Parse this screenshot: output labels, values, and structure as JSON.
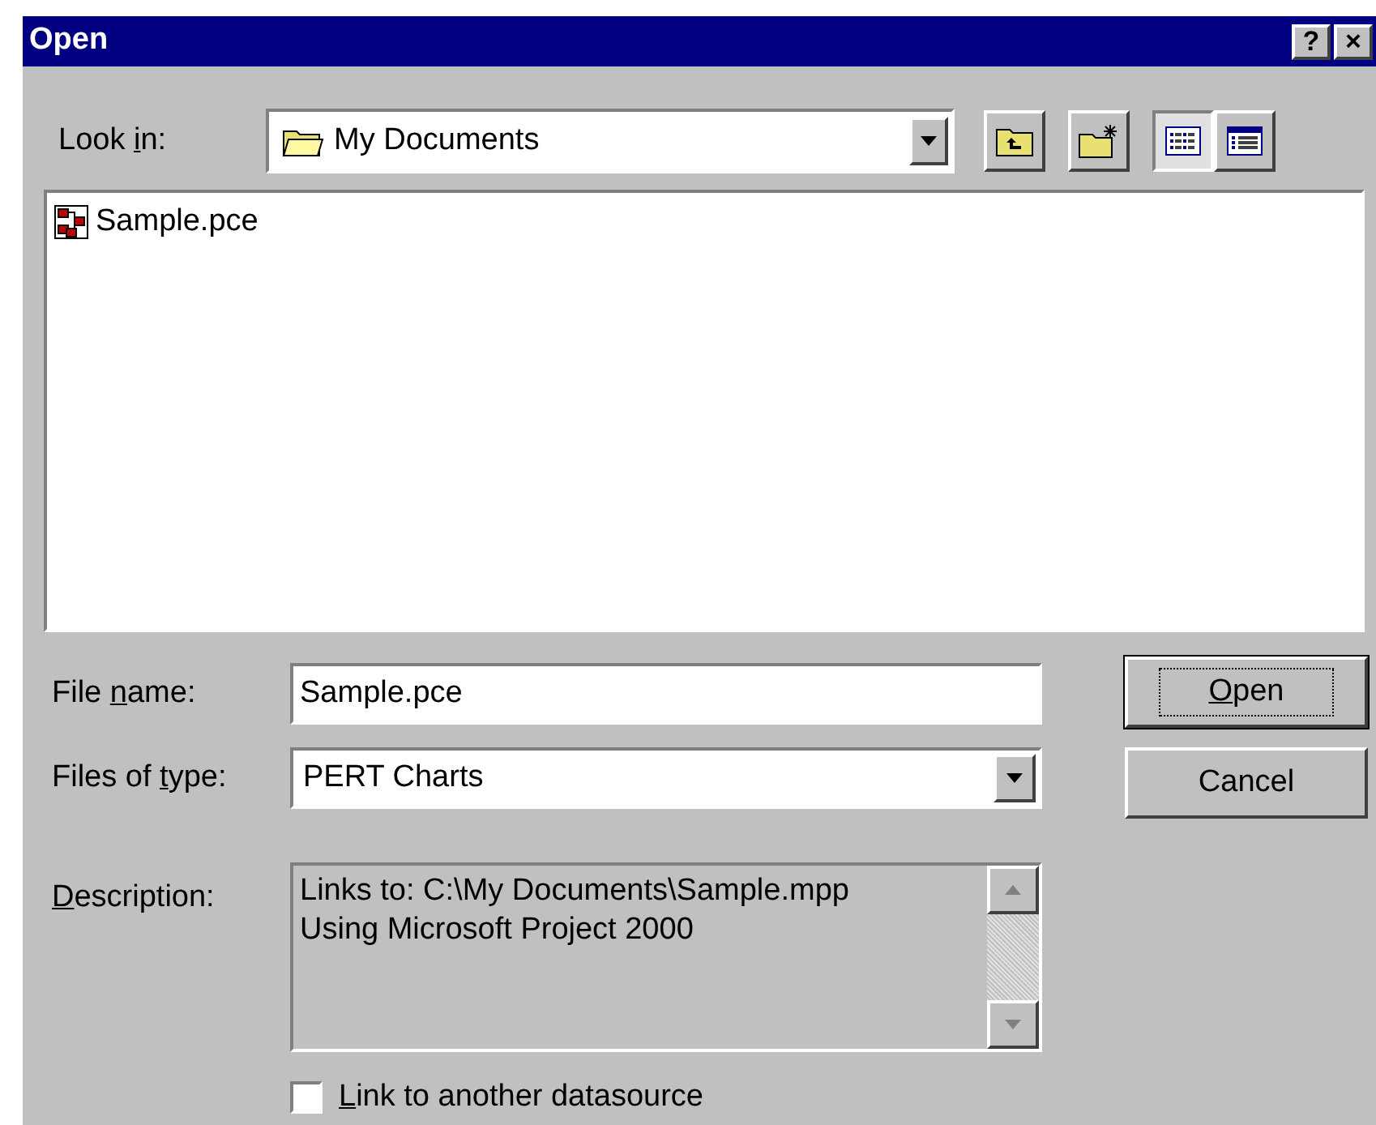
{
  "window": {
    "title": "Open",
    "title_buttons": [
      "?",
      "×"
    ]
  },
  "look_in": {
    "label": {
      "before": "Look ",
      "key": "i",
      "after": "n:"
    },
    "value": "My Documents"
  },
  "toolbar": [
    {
      "kind": "up",
      "selected": false
    },
    {
      "kind": "new-folder",
      "selected": false
    },
    {
      "kind": "list",
      "selected": true
    },
    {
      "kind": "details",
      "selected": false
    }
  ],
  "files": [
    {
      "name": "Sample.pce"
    }
  ],
  "file_name": {
    "label": {
      "before": "File ",
      "key": "n",
      "after": "ame:"
    },
    "value": "Sample.pce"
  },
  "file_type": {
    "label": {
      "before": "Files of ",
      "key": "t",
      "after": "ype:"
    },
    "value": "PERT Charts"
  },
  "buttons": [
    {
      "label": {
        "key": "O",
        "after": "pen"
      },
      "default": true
    },
    {
      "label": {
        "before": "Cancel"
      },
      "default": false
    }
  ],
  "description": {
    "label": {
      "key": "D",
      "after": "escription:"
    },
    "lines": [
      "Links to: C:\\My Documents\\Sample.mpp",
      "Using Microsoft Project 2000"
    ]
  },
  "link_option": {
    "label": {
      "key": "L",
      "after": "ink to another datasource"
    },
    "checked": false
  }
}
